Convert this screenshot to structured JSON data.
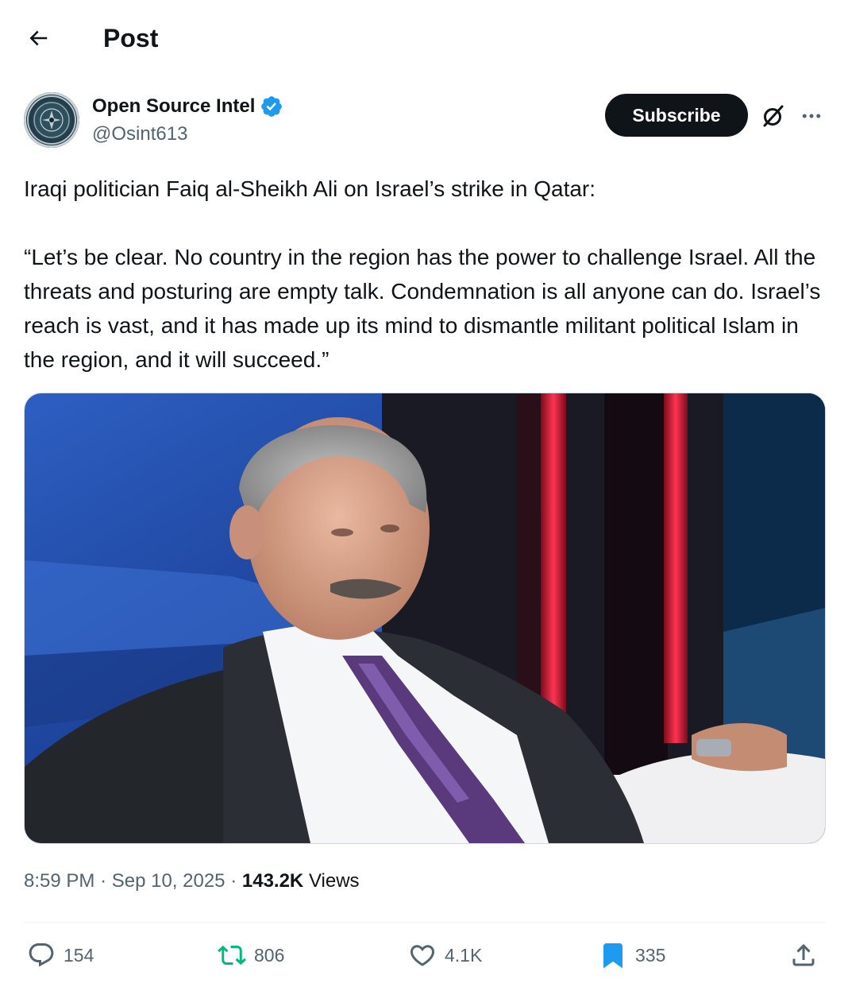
{
  "header": {
    "title": "Post"
  },
  "author": {
    "name": "Open Source Intel",
    "handle": "@Osint613",
    "verified": true,
    "verified_color": "#1d9bf0"
  },
  "buttons": {
    "subscribe_label": "Subscribe"
  },
  "icons": [
    "back-arrow-icon",
    "verified-badge-icon",
    "grok-icon",
    "more-icon",
    "reply-icon",
    "repost-icon",
    "like-icon",
    "bookmark-icon",
    "share-icon"
  ],
  "tweet": {
    "intro": "Iraqi politician Faiq al-Sheikh Ali on Israel’s strike in Qatar:",
    "quote": "“Let’s be clear. No country in the region has the power to challenge Israel. All the threats and posturing are empty talk. Condemnation is all anyone can do. Israel’s reach is vast, and it has made up its mind to dismantle militant political Islam in the region, and it will succeed.”"
  },
  "meta": {
    "time": "8:59 PM",
    "separator": "·",
    "date": "Sep 10, 2025",
    "views_count": "143.2K",
    "views_label": "Views"
  },
  "actions": {
    "replies": "154",
    "reposts": "806",
    "likes": "4.1K",
    "bookmarks": "335"
  },
  "colors": {
    "text": "#0f1419",
    "secondary": "#536471",
    "repost_active": "#00ba7c",
    "bookmark_active": "#1d9bf0"
  }
}
